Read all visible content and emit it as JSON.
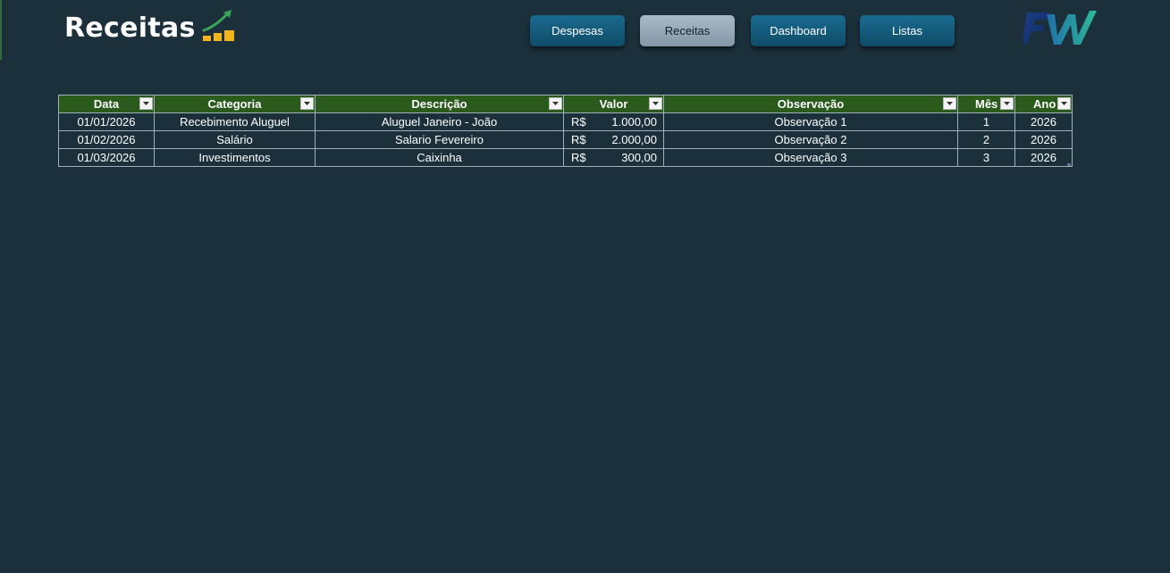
{
  "header": {
    "title": "Receitas",
    "icon": "bar-chart-growth-icon",
    "logo_text": "FW"
  },
  "nav": {
    "buttons": [
      {
        "label": "Despesas",
        "active": false
      },
      {
        "label": "Receitas",
        "active": true
      },
      {
        "label": "Dashboard",
        "active": false
      },
      {
        "label": "Listas",
        "active": false
      }
    ]
  },
  "table": {
    "columns": [
      "Data",
      "Categoria",
      "Descrição",
      "Valor",
      "Observação",
      "Mês",
      "Ano"
    ],
    "rows": [
      {
        "data": "01/01/2026",
        "categoria": "Recebimento Aluguel",
        "descricao": "Aluguel Janeiro - João",
        "moeda": "R$",
        "valor": "1.000,00",
        "observacao": "Observação 1",
        "mes": "1",
        "ano": "2026"
      },
      {
        "data": "01/02/2026",
        "categoria": "Salário",
        "descricao": "Salario Fevereiro",
        "moeda": "R$",
        "valor": "2.000,00",
        "observacao": "Observação 2",
        "mes": "2",
        "ano": "2026"
      },
      {
        "data": "01/03/2026",
        "categoria": "Investimentos",
        "descricao": "Caixinha",
        "moeda": "R$",
        "valor": "300,00",
        "observacao": "Observação 3",
        "mes": "3",
        "ano": "2026"
      }
    ]
  },
  "colors": {
    "background": "#1b303b",
    "header_green": "#2a5a1c",
    "button_blue": "#13587a",
    "button_active": "#9aaab8"
  }
}
